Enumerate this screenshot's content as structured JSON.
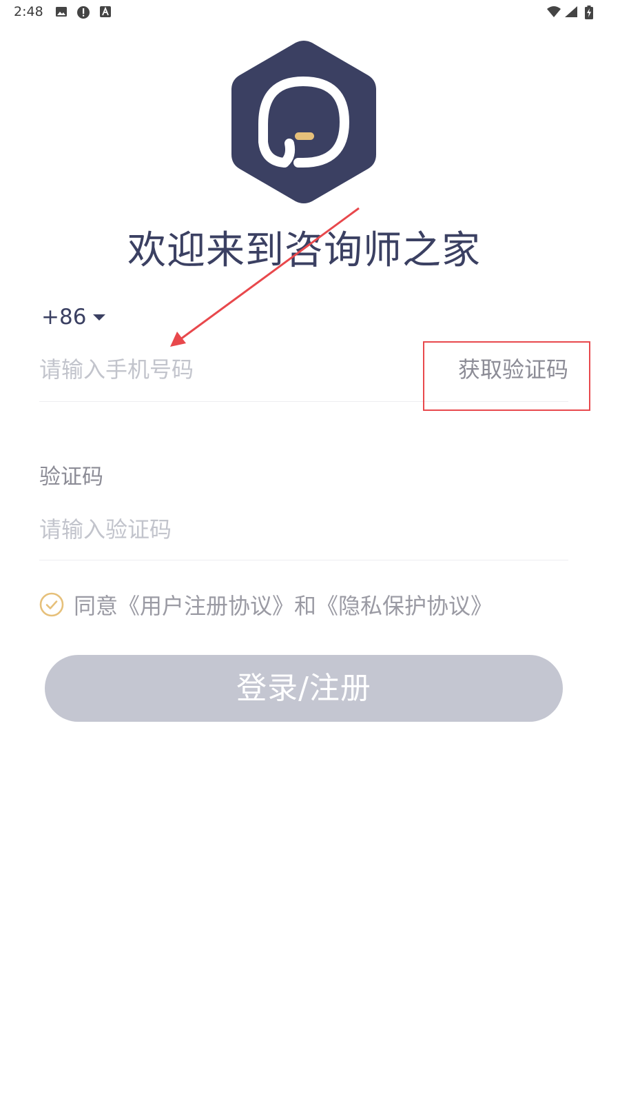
{
  "status_bar": {
    "time": "2:48",
    "left_icons": [
      "image-icon",
      "alert-icon",
      "text-a-icon"
    ],
    "right_icons": [
      "wifi-icon",
      "signal-icon",
      "battery-charging-icon"
    ]
  },
  "header": {
    "logo_icon": "chat-bubble-hexagon-logo",
    "welcome_text": "欢迎来到咨询师之家"
  },
  "phone": {
    "country_code": "+86",
    "placeholder": "请输入手机号码",
    "get_code_label": "获取验证码"
  },
  "verify": {
    "label": "验证码",
    "placeholder": "请输入验证码"
  },
  "agreement": {
    "prefix": "同意",
    "user_agreement": "《用户注册协议》",
    "conjunction": "和",
    "privacy_agreement": "《隐私保护协议》",
    "checked": true
  },
  "login_button": {
    "label": "登录/注册"
  },
  "colors": {
    "brand": "#3b4062",
    "accent_gold": "#e6c07a",
    "button_disabled": "#c4c6d1",
    "annotation_red": "#e8484c"
  }
}
